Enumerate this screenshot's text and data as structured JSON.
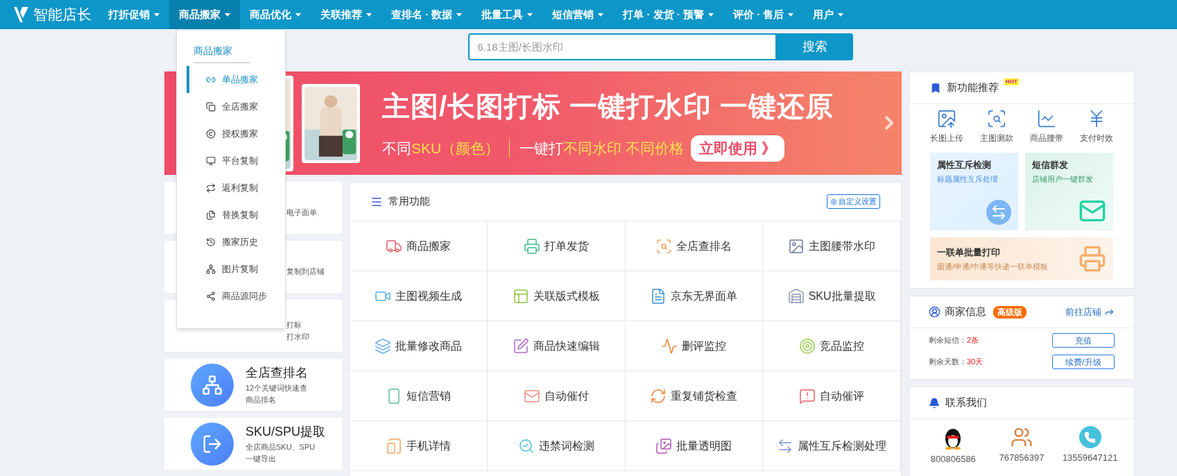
{
  "nav": {
    "logo": "智能店长",
    "items": [
      {
        "label": "打折促销",
        "selected": false
      },
      {
        "label": "商品搬家",
        "selected": true
      },
      {
        "label": "商品优化",
        "selected": false
      },
      {
        "label": "关联推荐",
        "selected": false
      },
      {
        "label": "查排名 · 数据",
        "selected": false
      },
      {
        "label": "批量工具",
        "selected": false
      },
      {
        "label": "短信营销",
        "selected": false
      },
      {
        "label": "打单 · 发货 · 预警",
        "selected": false
      },
      {
        "label": "评价 · 售后",
        "selected": false
      },
      {
        "label": "用户",
        "selected": false
      }
    ]
  },
  "dropdown": {
    "title": "商品搬家",
    "items": [
      {
        "label": "单品搬家",
        "selected": true
      },
      {
        "label": "全店搬家",
        "selected": false
      },
      {
        "label": "授权搬家",
        "selected": false
      },
      {
        "label": "平台复制",
        "selected": false
      },
      {
        "label": "返利复制",
        "selected": false
      },
      {
        "label": "替换复制",
        "selected": false
      },
      {
        "label": "搬家历史",
        "selected": false
      },
      {
        "label": "图片复制",
        "selected": false
      },
      {
        "label": "商品源同步",
        "selected": false
      }
    ]
  },
  "search": {
    "placeholder": "6.18主图/长图水印",
    "button": "搜索"
  },
  "banner": {
    "headline": "主图/长图打标 一键打水印 一键还原",
    "segments": [
      {
        "text": "不同",
        "highlight": false
      },
      {
        "text": "SKU（颜色）",
        "highlight": true
      },
      {
        "text": "一键打",
        "highlight": false
      },
      {
        "text": "不同水印 不同价格",
        "highlight": true
      }
    ],
    "cta": "立即使用 》"
  },
  "side_cards": [
    {
      "kind": "hidden",
      "desc": [
        "电子面单"
      ]
    },
    {
      "kind": "hidden",
      "desc": [
        "复制到店铺"
      ]
    },
    {
      "kind": "hidden",
      "desc": [
        "打标",
        "打水印"
      ]
    },
    {
      "kind": "full",
      "title": "全店查排名",
      "desc": [
        "12个关键词快速查",
        "商品排名"
      ]
    },
    {
      "kind": "full",
      "title": "SKU/SPU提取",
      "desc": [
        "全店商品SKU、SPU",
        "一键导出"
      ]
    }
  ],
  "common": {
    "title": "常用功能",
    "settings": "自定义设置",
    "items": [
      "商品搬家",
      "打单发货",
      "全店查排名",
      "主图腰带水印",
      "主图视频生成",
      "关联版式模板",
      "京东无界面单",
      "SKU批量提取",
      "批量修改商品",
      "商品快速编辑",
      "删评监控",
      "竞品监控",
      "短信营销",
      "自动催付",
      "重复铺货检查",
      "自动催评",
      "手机详情",
      "违禁词检测",
      "批量透明图",
      "属性互斥检测处理"
    ]
  },
  "new_features": {
    "title": "新功能推荐",
    "badge": "HOT",
    "icons": [
      "长图上传",
      "主图测款",
      "商品腰带",
      "支付时效"
    ],
    "tiles": [
      {
        "title": "属性互斥检测",
        "subtitle": "标题属性互斥处理"
      },
      {
        "title": "短信群发",
        "subtitle": "店铺用户一键群发"
      },
      {
        "title": "一联单批量打印",
        "subtitle": "圆通/申通/中通等快递一联单模板"
      }
    ]
  },
  "merchant": {
    "title": "商家信息",
    "badge": "高级版",
    "link": "前往店铺",
    "rows": [
      {
        "label": "剩余短信：",
        "value": "2条",
        "button": "充值"
      },
      {
        "label": "剩余天数：",
        "value": "30天",
        "button": "续费/升级"
      }
    ]
  },
  "contact": {
    "title": "联系我们",
    "items": [
      "800806586",
      "767856397",
      "13559647121"
    ]
  }
}
